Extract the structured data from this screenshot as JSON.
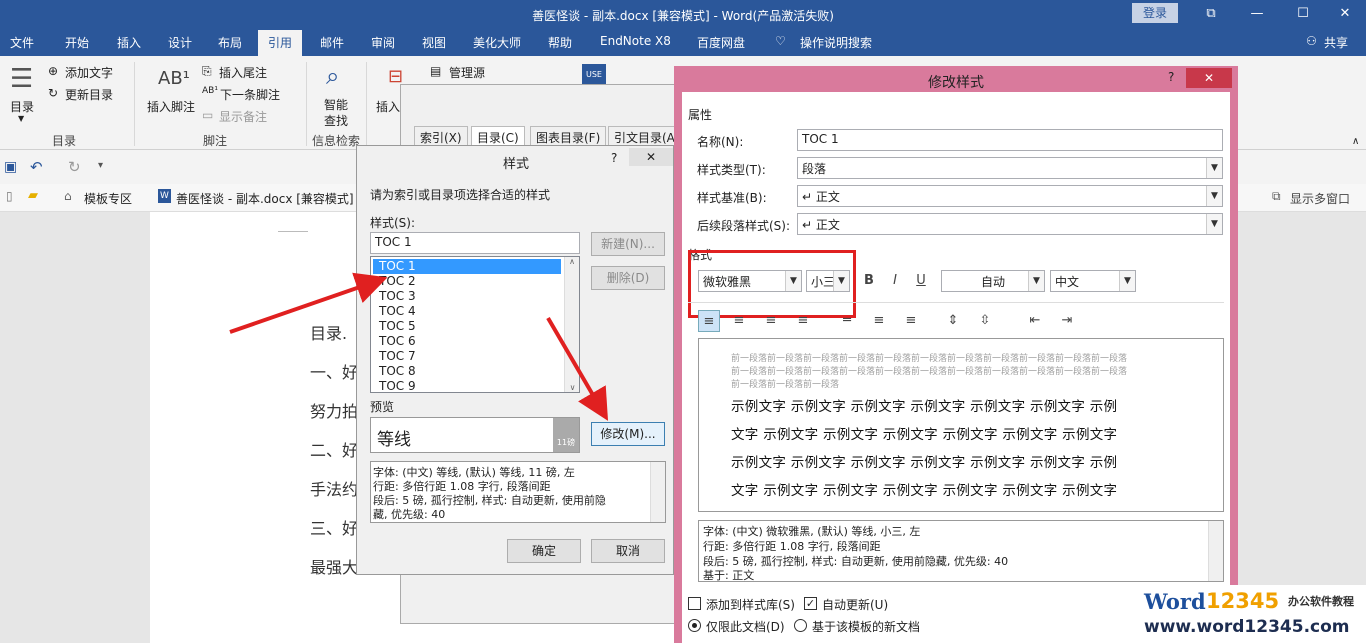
{
  "titlebar": {
    "title": "善医怪谈 - 副本.docx [兼容模式]  -  Word(产品激活失败)",
    "login": "登录"
  },
  "tabs": [
    "文件",
    "开始",
    "插入",
    "设计",
    "布局",
    "引用",
    "邮件",
    "审阅",
    "视图",
    "美化大师",
    "帮助",
    "EndNote X8",
    "百度网盘",
    "操作说明搜索"
  ],
  "share": "共享",
  "ribbon": {
    "toc_big": "目录",
    "add_text": "添加文字",
    "update_toc": "更新目录",
    "group_toc": "目录",
    "insert_footnote": "插入脚注",
    "insert_endnote": "插入尾注",
    "next_footnote": "下一条脚注",
    "show_notes": "显示备注",
    "group_footnote": "脚注",
    "smart_lookup": "智能\n查找",
    "smart_lookup_1": "智能",
    "smart_lookup_2": "查找",
    "group_research": "信息检索",
    "insert_cite": "插入",
    "manage_source": "管理源"
  },
  "doctabs": {
    "templates": "模板专区",
    "file": "善医怪谈 - 副本.docx [兼容模式]",
    "multi": "显示多窗口"
  },
  "document": {
    "lines": [
      "目录.",
      "一、好",
      "努力拍",
      "二、好",
      "手法约",
      "三、好",
      "最强大"
    ]
  },
  "bg_dialog": {
    "tabs": [
      "索引(X)",
      "目录(C)",
      "图表目录(F)",
      "引文目录(A)"
    ]
  },
  "style_dialog": {
    "title": "样式",
    "instruction": "请为索引或目录项选择合适的样式",
    "styles_label": "样式(S):",
    "current": "TOC 1",
    "items": [
      "TOC 1",
      "TOC 2",
      "TOC 3",
      "TOC 4",
      "TOC 5",
      "TOC 6",
      "TOC 7",
      "TOC 8",
      "TOC 9"
    ],
    "new_btn": "新建(N)...",
    "delete_btn": "删除(D)",
    "preview_label": "预览",
    "preview_font": "等线",
    "preview_size": "11磅",
    "description": [
      "字体: (中文) 等线, (默认) 等线, 11 磅, 左",
      "    行距: 多倍行距 1.08 字行, 段落间距",
      "    段后: 5 磅, 孤行控制, 样式: 自动更新, 使用前隐",
      "藏, 优先级: 40"
    ],
    "modify_btn": "修改(M)...",
    "ok_btn": "确定",
    "cancel_btn": "取消"
  },
  "modify_dialog": {
    "title": "修改样式",
    "properties_label": "属性",
    "name_label": "名称(N):",
    "name_value": "TOC 1",
    "type_label": "样式类型(T):",
    "type_value": "段落",
    "based_label": "样式基准(B):",
    "based_value": "↵ 正文",
    "next_label": "后续段落样式(S):",
    "next_value": "↵ 正文",
    "format_label": "格式",
    "font": "微软雅黑",
    "size": "小三",
    "bold": "B",
    "italic": "I",
    "underline": "U",
    "color": "自动",
    "script": "中文",
    "prev_para": "前一段落前一段落前一段落前一段落前一段落前一段落前一段落前一段落前一段落前一段落前一段落",
    "prev_para_end": "前一段落前一段落前一段落",
    "sample_lines": [
      "示例文字 示例文字 示例文字 示例文字 示例文字 示例文字 示例",
      "文字 示例文字 示例文字 示例文字 示例文字 示例文字 示例文字",
      "示例文字 示例文字 示例文字 示例文字 示例文字 示例文字 示例",
      "文字 示例文字 示例文字 示例文字 示例文字 示例文字 示例文字"
    ],
    "description": [
      "字体: (中文) 微软雅黑, (默认) 等线, 小三, 左",
      "    行距: 多倍行距 1.08 字行, 段落间距",
      "    段后: 5 磅, 孤行控制, 样式: 自动更新, 使用前隐藏, 优先级: 40",
      "    基于: 正文"
    ],
    "add_gallery": "添加到样式库(S)",
    "auto_update": "自动更新(U)",
    "only_doc": "仅限此文档(D)",
    "new_docs": "基于该模板的新文档"
  },
  "watermark": {
    "brand_word": "Word",
    "brand_num": "12345",
    "tagline": "办公软件教程",
    "url": "www.word12345.com"
  },
  "colors": {
    "word_blue": "#2b579a",
    "dialog_pink": "#d97a9c",
    "highlight_red": "#e02020",
    "selection": "#3399ff"
  }
}
